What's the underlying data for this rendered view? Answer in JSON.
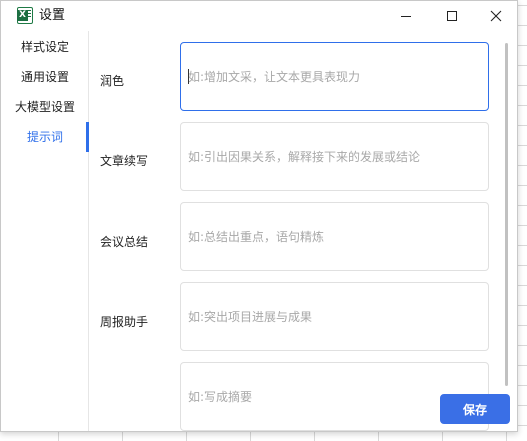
{
  "window": {
    "title": "设置",
    "app_icon_letter": "X"
  },
  "sidebar": {
    "items": [
      {
        "label": "样式设定",
        "active": false
      },
      {
        "label": "通用设置",
        "active": false
      },
      {
        "label": "大模型设置",
        "active": false
      },
      {
        "label": "提示词",
        "active": true
      }
    ]
  },
  "prompts": [
    {
      "label": "润色",
      "placeholder": "如:增加文采，让文本更具表现力",
      "focused": true
    },
    {
      "label": "文章续写",
      "placeholder": "如:引出因果关系，解释接下来的发展或结论",
      "focused": false
    },
    {
      "label": "会议总结",
      "placeholder": "如:总结出重点，语句精炼",
      "focused": false
    },
    {
      "label": "周报助手",
      "placeholder": "如:突出项目进展与成果",
      "focused": false
    },
    {
      "label": "",
      "placeholder": "如:写成摘要",
      "focused": false
    }
  ],
  "actions": {
    "save_label": "保存"
  },
  "colors": {
    "accent": "#2f6fea",
    "save_button": "#3a6fe6",
    "excel_green": "#1d6f42"
  }
}
